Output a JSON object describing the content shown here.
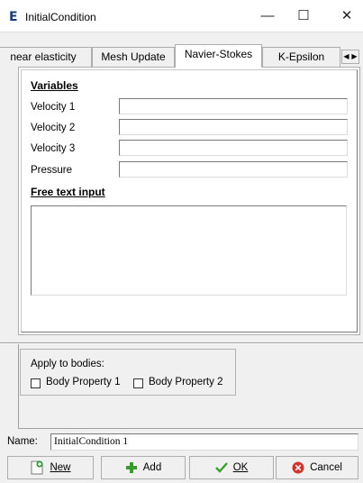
{
  "window": {
    "app_icon_letter": "E",
    "title": "InitialCondition",
    "minimize_glyph": "—",
    "maximize_glyph": "☐",
    "close_glyph": "✕"
  },
  "tabs": [
    {
      "label": "near elasticity"
    },
    {
      "label": "Mesh Update"
    },
    {
      "label": "Navier-Stokes",
      "active": true
    },
    {
      "label": "K-Epsilon"
    }
  ],
  "tab_scroll": {
    "left": "◀",
    "right": "▶"
  },
  "variables": {
    "heading": "Variables",
    "fields": [
      {
        "label": "Velocity 1",
        "value": ""
      },
      {
        "label": "Velocity 2",
        "value": ""
      },
      {
        "label": "Velocity 3",
        "value": ""
      },
      {
        "label": "Pressure",
        "value": ""
      }
    ]
  },
  "free_text": {
    "heading": "Free text input",
    "value": ""
  },
  "bodies": {
    "group_label": "Apply to bodies:",
    "items": [
      {
        "label": "Body Property 1",
        "checked": false
      },
      {
        "label": "Body Property 2",
        "checked": false
      }
    ]
  },
  "name_field": {
    "label": "Name:",
    "value": "InitialCondition 1"
  },
  "buttons": {
    "new_label": "New",
    "add_label": "Add",
    "ok_label": "OK",
    "cancel_label": "Cancel"
  },
  "colors": {
    "add_icon": "#3a9a2e",
    "ok_icon": "#3aa02c",
    "cancel_icon": "#d0342c",
    "new_icon": "#2a9a3a"
  }
}
